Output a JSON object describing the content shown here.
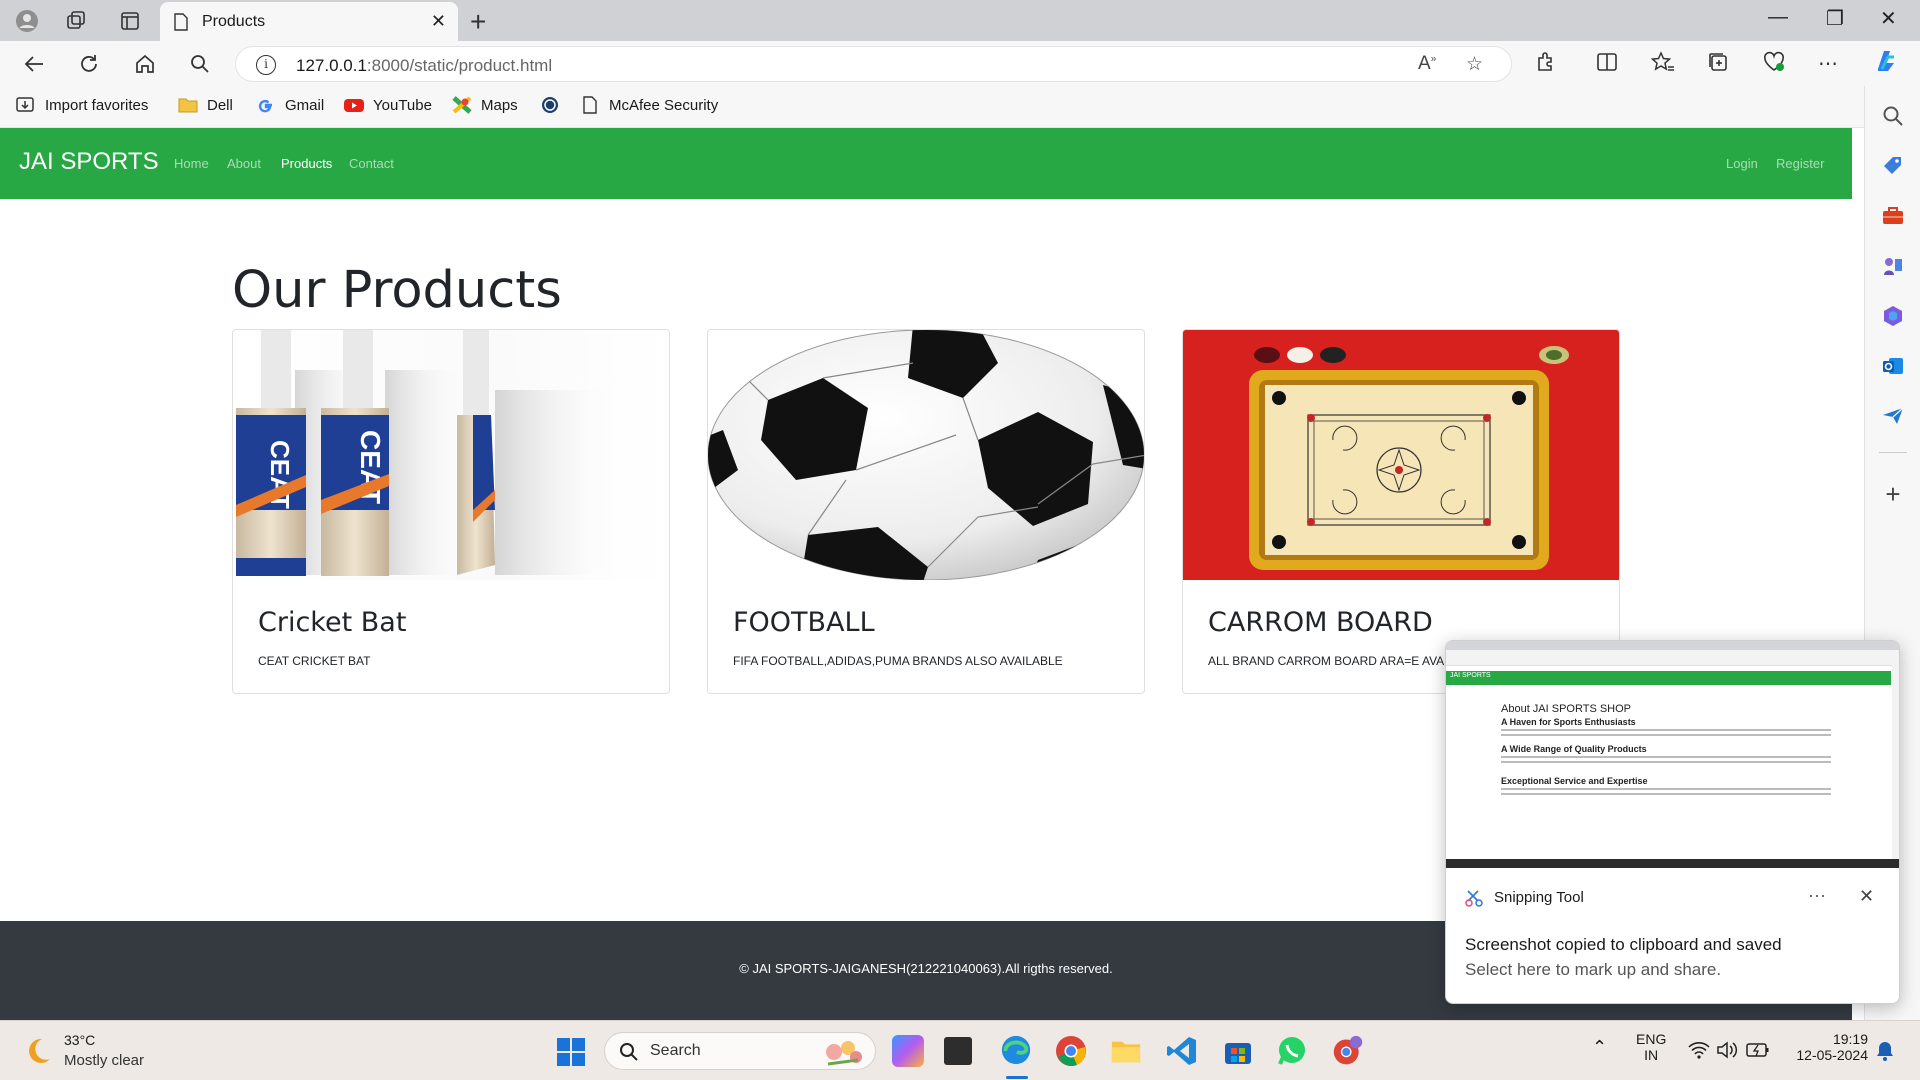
{
  "browser": {
    "tab_title": "Products",
    "url_host": "127.0.0.1",
    "url_rest": ":8000/static/product.html",
    "bookmarks": [
      "Import favorites",
      "Dell",
      "Gmail",
      "YouTube",
      "Maps",
      "McAfee Security"
    ]
  },
  "site": {
    "brand": "JAI SPORTS",
    "nav": [
      "Home",
      "About",
      "Products",
      "Contact"
    ],
    "nav_active": "Products",
    "nav_right": [
      "Login",
      "Register"
    ],
    "accent_color": "#28a745",
    "heading": "Our Products",
    "products": [
      {
        "title": "Cricket Bat",
        "text": "CEAT CRICKET BAT",
        "image": "cricket-bats"
      },
      {
        "title": "FOOTBALL",
        "text": "FIFA FOOTBALL,ADIDAS,PUMA BRANDS ALSO AVAILABLE",
        "image": "football"
      },
      {
        "title": "CARROM BOARD",
        "text": "ALL BRAND CARROM BOARD ARA=E AVAILABLE",
        "image": "carrom-board"
      }
    ],
    "footer": "© JAI SPORTS-JAIGANESH(212221040063).All rigths reserved."
  },
  "toast": {
    "app_name": "Snipping Tool",
    "message": "Screenshot copied to clipboard and saved",
    "sub": "Select here to mark up and share.",
    "thumb": {
      "brand": "JAI SPORTS",
      "h1": "About JAI SPORTS SHOP",
      "h2a": "A Haven for Sports Enthusiasts",
      "h2b": "A Wide Range of Quality Products",
      "h2c": "Exceptional Service and Expertise"
    }
  },
  "taskbar": {
    "temp": "33°C",
    "condition": "Mostly clear",
    "search": "Search",
    "lang1": "ENG",
    "lang2": "IN",
    "time": "19:19",
    "date": "12-05-2024"
  }
}
